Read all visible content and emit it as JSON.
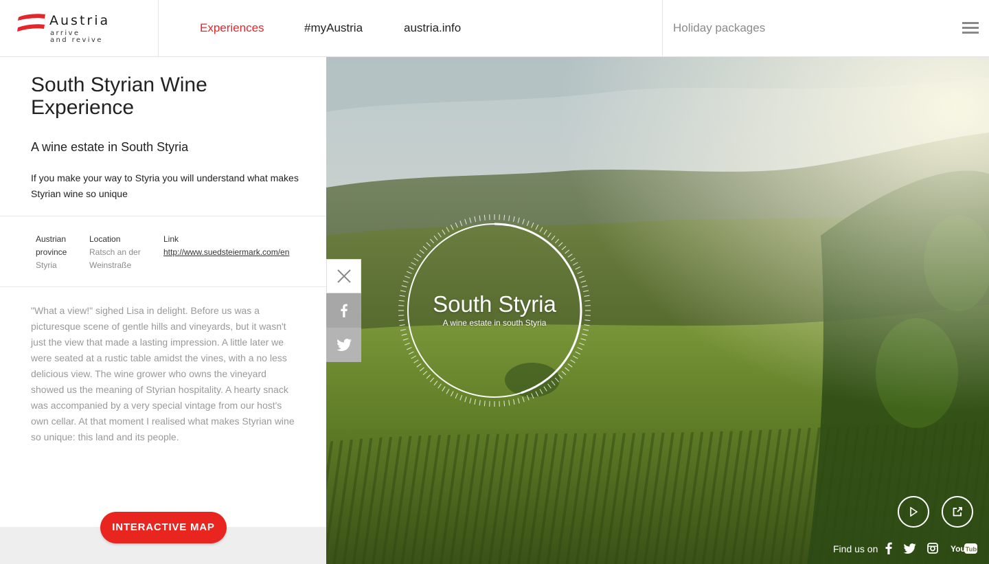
{
  "brand": {
    "title": "Austria",
    "tagline_line1": "arrive",
    "tagline_line2": "and revive",
    "flag_color": "#e4262b"
  },
  "nav": {
    "items": [
      {
        "label": "Experiences",
        "active": true
      },
      {
        "label": "#myAustria",
        "active": false
      },
      {
        "label": "austria.info",
        "active": false
      }
    ],
    "holiday_packages": "Holiday packages",
    "menu_icon": "hamburger-icon"
  },
  "article": {
    "title": "South Styrian Wine Experience",
    "subtitle": "A wine estate in South Styria",
    "intro": "If you make your way to Styria you will understand what makes Styrian wine so unique",
    "meta": {
      "province_label_1": "Austrian",
      "province_label_2": "province",
      "province_value": "Styria",
      "location_label": "Location",
      "location_value_1": "Ratsch an der",
      "location_value_2": "Weinstraße",
      "link_label": "Link",
      "link_value": "http://www.suedsteiermark.com/en"
    },
    "story": "\"What a view!\" sighed Lisa in delight. Before us was a picturesque scene of gentle hills and vineyards, but it wasn't just the view that made a lasting impression. A little later we were seated at a rustic table amidst the vines, with a no less delicious view. The wine grower who owns the vineyard showed us the meaning of Styrian hospitality. A hearty snack was accompanied by a very special vintage from our host's own cellar. At that moment I realised what makes Styrian wine so unique: this land and its people.",
    "map_button": "INTERACTIVE MAP"
  },
  "share": {
    "close_icon": "close-icon",
    "facebook_icon": "facebook-icon",
    "twitter_icon": "twitter-icon"
  },
  "hero": {
    "title": "South Styria",
    "subtitle": "A wine estate in south Styria",
    "progress": 0.45,
    "play_icon": "play-icon",
    "external_icon": "external-link-icon"
  },
  "footer": {
    "find_us": "Find us on",
    "social": [
      "facebook-icon",
      "twitter-icon",
      "instagram-icon",
      "youtube-icon"
    ],
    "youtube_label": "YouTube"
  },
  "colors": {
    "accent": "#e4262b",
    "button": "#e8261f",
    "muted_text": "#999999"
  }
}
